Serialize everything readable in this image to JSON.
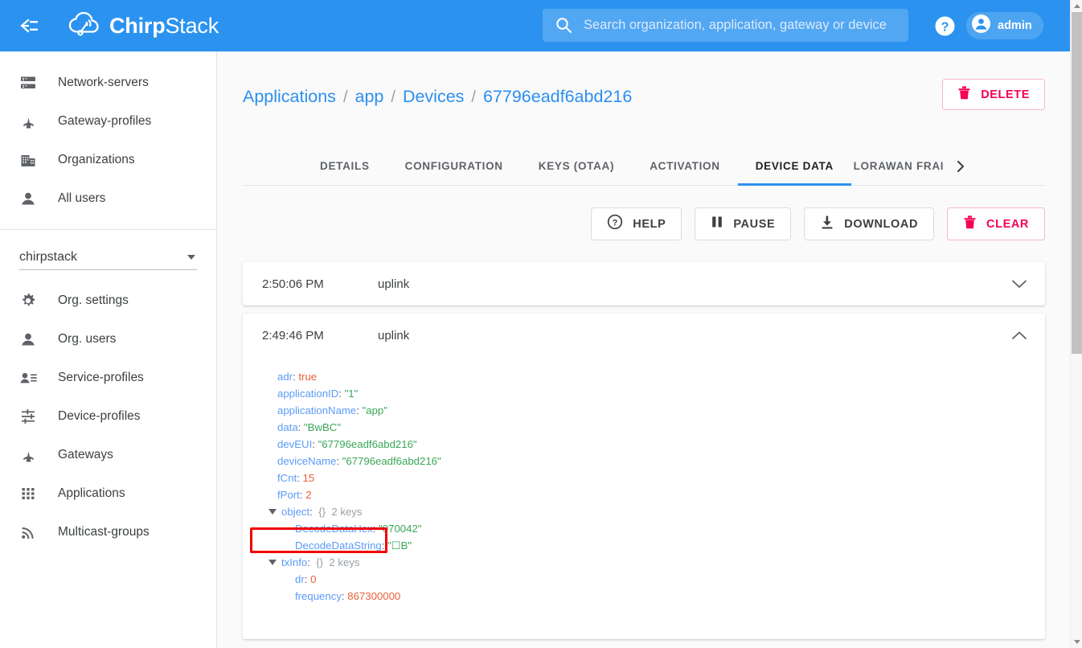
{
  "colors": {
    "appbar_blue": "#2b93ef",
    "link_blue": "#2b8fef",
    "accent_pink": "#f50057",
    "annotation_red": "#f20000",
    "json_key": "#5b9bf8",
    "json_string": "#3aa757",
    "json_number": "#e8603c"
  },
  "appbar": {
    "collapse_icon": "menu-collapse-icon",
    "brand_bold": "Chirp",
    "brand_light": "Stack",
    "logo_icon": "chirpstack-cloud-icon",
    "search": {
      "icon": "search-icon",
      "placeholder": "Search organization, application, gateway or device",
      "value": ""
    },
    "help_icon": "help-circle-icon",
    "user": {
      "icon": "account-circle-icon",
      "label": "admin"
    }
  },
  "sidebar": {
    "global_items": [
      {
        "label": "Network-servers",
        "icon": "server-icon"
      },
      {
        "label": "Gateway-profiles",
        "icon": "antenna-icon"
      },
      {
        "label": "Organizations",
        "icon": "building-icon"
      },
      {
        "label": "All users",
        "icon": "person-icon"
      }
    ],
    "org_selector": {
      "value": "chirpstack",
      "caret_icon": "chevron-down-icon"
    },
    "org_items": [
      {
        "label": "Org. settings",
        "icon": "gear-icon"
      },
      {
        "label": "Org. users",
        "icon": "person-icon"
      },
      {
        "label": "Service-profiles",
        "icon": "person-list-icon"
      },
      {
        "label": "Device-profiles",
        "icon": "sliders-icon"
      },
      {
        "label": "Gateways",
        "icon": "antenna-icon"
      },
      {
        "label": "Applications",
        "icon": "grid-apps-icon"
      },
      {
        "label": "Multicast-groups",
        "icon": "rss-broadcast-icon"
      }
    ]
  },
  "breadcrumb": {
    "separator": "/",
    "items": [
      {
        "label": "Applications",
        "link": true
      },
      {
        "label": "app",
        "link": true
      },
      {
        "label": "Devices",
        "link": true
      },
      {
        "label": "67796eadf6abd216",
        "link": true
      }
    ]
  },
  "header_actions": {
    "delete": {
      "label": "DELETE",
      "icon": "trash-icon"
    }
  },
  "tabs": {
    "items": [
      {
        "label": "DETAILS",
        "active": false
      },
      {
        "label": "CONFIGURATION",
        "active": false
      },
      {
        "label": "KEYS (OTAA)",
        "active": false
      },
      {
        "label": "ACTIVATION",
        "active": false
      },
      {
        "label": "DEVICE DATA",
        "active": true
      },
      {
        "label": "LORAWAN FRAI",
        "active": false,
        "truncated": true
      }
    ],
    "next_icon": "chevron-right-icon"
  },
  "toolbar": {
    "buttons": [
      {
        "label": "HELP",
        "icon": "help-circle-icon",
        "style": "default"
      },
      {
        "label": "PAUSE",
        "icon": "pause-icon",
        "style": "default"
      },
      {
        "label": "DOWNLOAD",
        "icon": "download-icon",
        "style": "default"
      },
      {
        "label": "CLEAR",
        "icon": "trash-icon",
        "style": "danger"
      }
    ]
  },
  "events": [
    {
      "time": "2:50:06 PM",
      "type": "uplink",
      "expanded": false,
      "chevron_icon": "chevron-down-icon",
      "fields": []
    },
    {
      "time": "2:49:46 PM",
      "type": "uplink",
      "expanded": true,
      "chevron_icon": "chevron-up-icon",
      "fields": [
        {
          "level": 0,
          "key": "adr",
          "value": "true",
          "kind": "bool"
        },
        {
          "level": 0,
          "key": "applicationID",
          "value": "\"1\"",
          "kind": "string"
        },
        {
          "level": 0,
          "key": "applicationName",
          "value": "\"app\"",
          "kind": "string"
        },
        {
          "level": 0,
          "key": "data",
          "value": "\"BwBC\"",
          "kind": "string"
        },
        {
          "level": 0,
          "key": "devEUI",
          "value": "\"67796eadf6abd216\"",
          "kind": "string"
        },
        {
          "level": 0,
          "key": "deviceName",
          "value": "\"67796eadf6abd216\"",
          "kind": "string"
        },
        {
          "level": 0,
          "key": "fCnt",
          "value": "15",
          "kind": "number"
        },
        {
          "level": 0,
          "key": "fPort",
          "value": "2",
          "kind": "number"
        },
        {
          "level": 0,
          "key": "object",
          "value": "{}",
          "meta": "2 keys",
          "kind": "object",
          "collapsible": true
        },
        {
          "level": 1,
          "key": "DecodeDataHex",
          "value": "\"070042\"",
          "kind": "string",
          "highlighted": true
        },
        {
          "level": 1,
          "key": "DecodeDataString",
          "value": "\"☐B\"",
          "kind": "string"
        },
        {
          "level": 0,
          "key": "txInfo",
          "value": "{}",
          "meta": "2 keys",
          "kind": "object",
          "collapsible": true
        },
        {
          "level": 1,
          "key": "dr",
          "value": "0",
          "kind": "number"
        },
        {
          "level": 1,
          "key": "frequency",
          "value": "867300000",
          "kind": "number"
        }
      ]
    }
  ],
  "annotation": {
    "target": "DecodeDataHex",
    "color": "#f20000"
  },
  "scrollbar": {
    "up_icon": "scroll-up-arrow-icon",
    "down_icon": "scroll-down-arrow-icon",
    "thumb_position": "top"
  }
}
